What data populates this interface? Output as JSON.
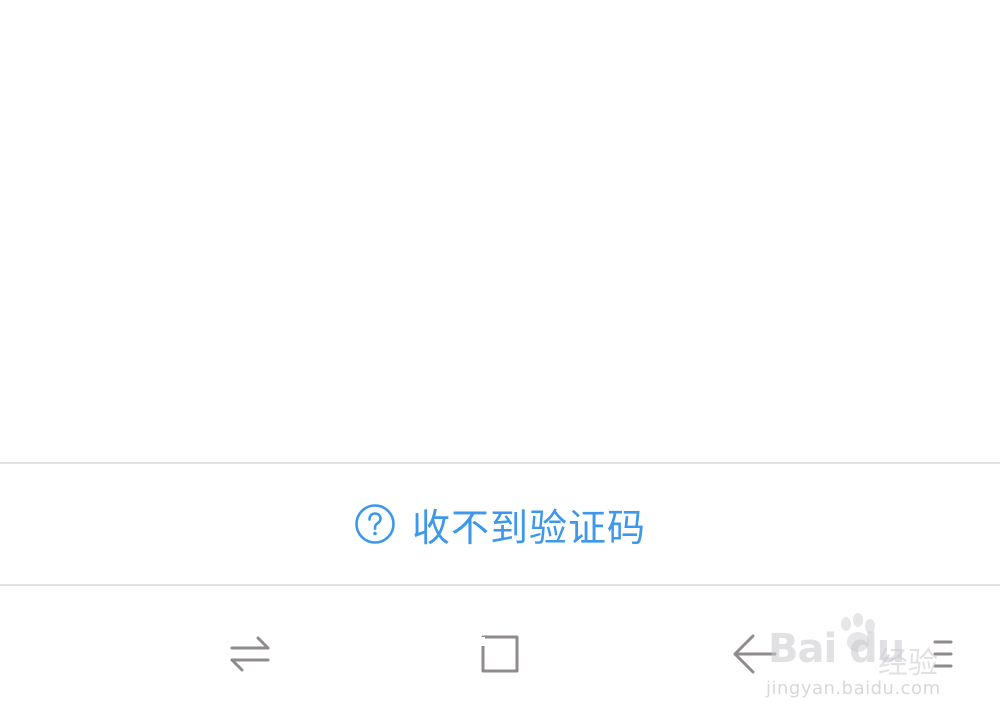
{
  "help": {
    "label": "收不到验证码",
    "icon": "question-circle-icon",
    "color": "#3d97ea"
  },
  "navbar": {
    "items": [
      {
        "name": "switch-apps",
        "icon": "swap-arrows-icon"
      },
      {
        "name": "home",
        "icon": "square-icon"
      },
      {
        "name": "back",
        "icon": "back-arrow-icon"
      },
      {
        "name": "menu",
        "icon": "menu-lines-icon"
      }
    ],
    "icon_color": "#8f8a8c"
  },
  "watermark": {
    "logo": "Bai du",
    "cn": "经验",
    "url": "jingyan.baidu.com"
  }
}
